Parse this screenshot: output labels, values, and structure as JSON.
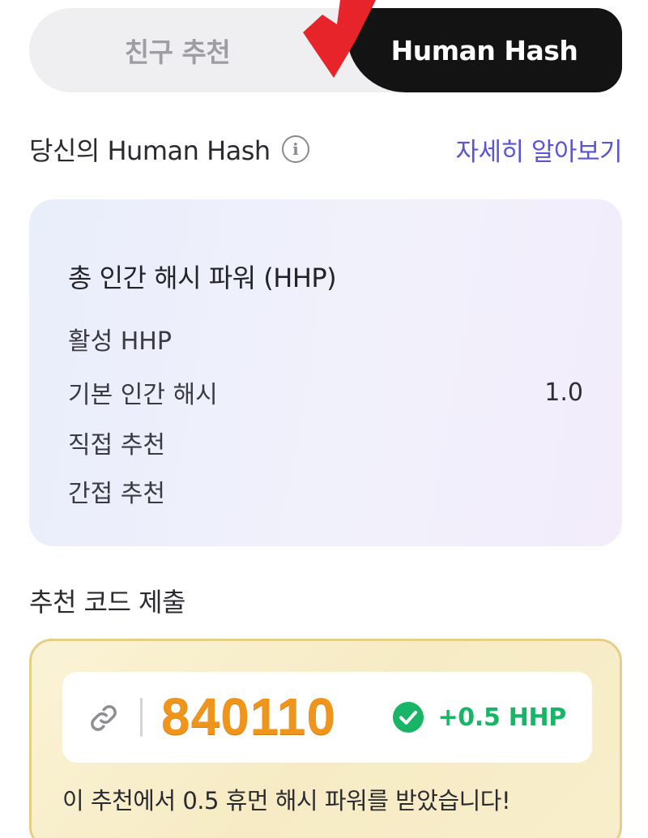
{
  "tabs": {
    "friend_referral": "친구 추천",
    "human_hash": "Human Hash"
  },
  "human_hash_section": {
    "title": "당신의 Human Hash",
    "info_icon": "info-icon",
    "learn_more": "자세히 알아보기"
  },
  "hhp_card": {
    "title": "총 인간 해시 파워 (HHP)",
    "rows": [
      {
        "label": "활성 HHP",
        "value": ""
      },
      {
        "label": "기본 인간 해시",
        "value": "1.0"
      },
      {
        "label": "직접 추천",
        "value": ""
      },
      {
        "label": "간접 추천",
        "value": ""
      }
    ]
  },
  "referral": {
    "title": "추천 코드 제출",
    "link_icon": "link-icon",
    "code": "840110",
    "check_icon": "check-circle-icon",
    "bonus": "+0.5 HHP",
    "message": "이 추천에서 0.5 휴먼 해시 파워를 받았습니다!"
  },
  "colors": {
    "accent_link": "#5a54d6",
    "code_orange": "#ef951c",
    "success_green": "#18b566",
    "gold_border": "#e3cf86",
    "annotation_red": "#e8242b"
  }
}
